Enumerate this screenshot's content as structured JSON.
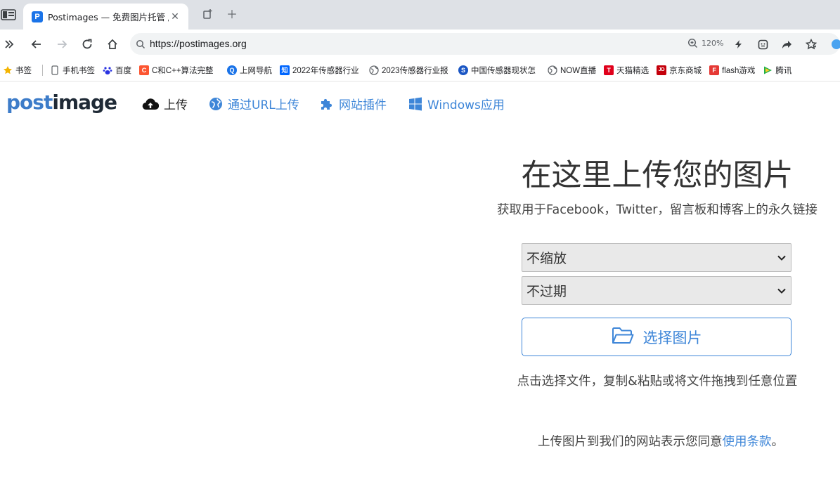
{
  "browser": {
    "tab": {
      "title": "Postimages — 免费图片托管 /",
      "favicon_letter": "P"
    },
    "url": "https://postimages.org",
    "zoom": "120%",
    "bookmarks": [
      {
        "label": "书签",
        "icon": "star-icon",
        "color": "#f4b400"
      },
      {
        "label": "手机书签",
        "icon": "phone-icon",
        "color": "#5f6368"
      },
      {
        "label": "百度",
        "icon": "baidu-icon",
        "color": "#2932e1"
      },
      {
        "label": "C和C++算法完整",
        "icon": "csdn-icon",
        "color": "#fc5531",
        "glyph": "C"
      },
      {
        "label": "上网导航",
        "icon": "nav-q-icon",
        "color": "#1a73e8",
        "glyph": "Q"
      },
      {
        "label": "2022年传感器行业",
        "icon": "zhihu-icon",
        "color": "#0066ff",
        "glyph": "知"
      },
      {
        "label": "2023传感器行业报",
        "icon": "globe-icon",
        "color": "#5f6368"
      },
      {
        "label": "中国传感器现状怎",
        "icon": "sogou-icon",
        "color": "#1a56c4",
        "glyph": "S"
      },
      {
        "label": "NOW直播",
        "icon": "globe-icon",
        "color": "#5f6368"
      },
      {
        "label": "天猫精选",
        "icon": "tmall-icon",
        "color": "#e0001b",
        "glyph": "T"
      },
      {
        "label": "京东商城",
        "icon": "jd-icon",
        "color": "#c4000b",
        "glyph": "JD"
      },
      {
        "label": "flash游戏",
        "icon": "flash-game-icon",
        "color": "#e53935",
        "glyph": "F"
      },
      {
        "label": "腾讯",
        "icon": "tencent-video-icon",
        "color": "#20b14a"
      }
    ]
  },
  "site": {
    "logo": {
      "part1": "post",
      "part2": "image"
    },
    "nav": {
      "upload": "上传",
      "url_upload": "通过URL上传",
      "plugins": "网站插件",
      "windows": "Windows应用"
    },
    "hero": {
      "title": "在这里上传您的图片",
      "subtitle": "获取用于Facebook，Twitter，留言板和博客上的永久链接"
    },
    "resize_select": {
      "value": "不缩放"
    },
    "expire_select": {
      "value": "不过期"
    },
    "choose_button": "选择图片",
    "hint": "点击选择文件，复制&粘贴或将文件拖拽到任意位置",
    "terms": {
      "prefix": "上传图片到我们的网站表示您同意",
      "link": "使用条款",
      "suffix": "。"
    }
  },
  "colors": {
    "link": "#3e86d8",
    "tabstrip": "#dee1e6",
    "omnibox": "#f1f3f4"
  }
}
